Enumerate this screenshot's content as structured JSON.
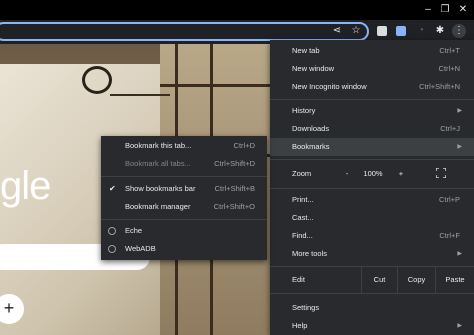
{
  "window": {
    "minimize_glyph": "–",
    "maximize_glyph": "❐",
    "close_glyph": "✕"
  },
  "toolbar": {
    "share_glyph": "⋖",
    "star_glyph": "☆",
    "puzzle_glyph": "✱",
    "kebab_glyph": "⋮"
  },
  "page": {
    "google_text": "gle",
    "new_shortcut_glyph": "+"
  },
  "menu": {
    "new_tab": "New tab",
    "new_tab_sc": "Ctrl+T",
    "new_window": "New window",
    "new_window_sc": "Ctrl+N",
    "new_incognito": "New Incognito window",
    "new_incognito_sc": "Ctrl+Shift+N",
    "history": "History",
    "downloads": "Downloads",
    "downloads_sc": "Ctrl+J",
    "bookmarks": "Bookmarks",
    "zoom": "Zoom",
    "zoom_minus": "-",
    "zoom_value": "100%",
    "zoom_plus": "+",
    "print": "Print...",
    "print_sc": "Ctrl+P",
    "cast": "Cast...",
    "find": "Find...",
    "find_sc": "Ctrl+F",
    "more_tools": "More tools",
    "edit": "Edit",
    "cut": "Cut",
    "copy": "Copy",
    "paste": "Paste",
    "settings": "Settings",
    "help": "Help"
  },
  "submenu": {
    "bookmark_tab": "Bookmark this tab...",
    "bookmark_tab_sc": "Ctrl+D",
    "bookmark_all": "Bookmark all tabs...",
    "bookmark_all_sc": "Ctrl+Shift+D",
    "show_bar": "Show bookmarks bar",
    "show_bar_sc": "Ctrl+Shift+B",
    "manager": "Bookmark manager",
    "manager_sc": "Ctrl+Shift+O",
    "bookmarks": [
      "Eche",
      "WebADB"
    ]
  }
}
